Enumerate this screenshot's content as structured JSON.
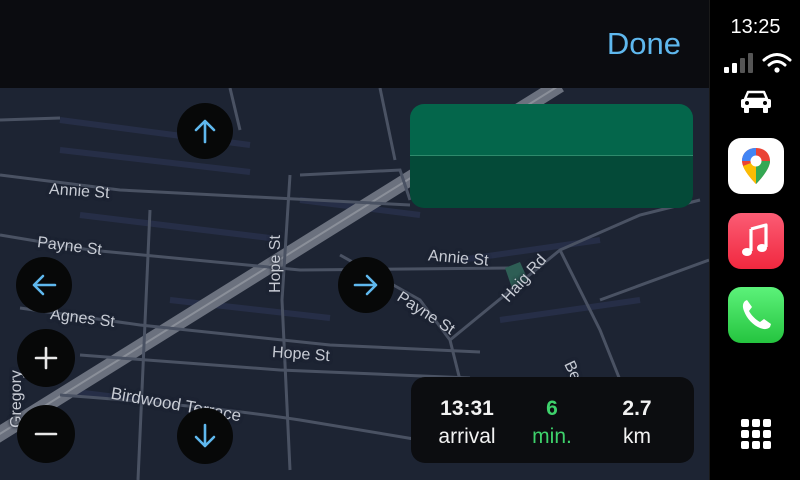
{
  "header": {
    "done_label": "Done"
  },
  "map": {
    "streets": [
      "Annie St",
      "Payne St",
      "Annie St",
      "Hope St",
      "Payne St",
      "Agnes St",
      "Hope St",
      "Haig Rd",
      "Birdwood Terrace",
      "Gregory",
      "Be"
    ]
  },
  "eta": {
    "arrival_time": "13:31",
    "arrival_label": "arrival",
    "minutes": "6",
    "minutes_label": "min.",
    "distance": "2.7",
    "distance_label": "km",
    "minutes_color": "#3ed16b"
  },
  "status": {
    "time": "13:25"
  },
  "icons": {
    "car": "car-icon",
    "maps": "google-maps-icon",
    "music": "music-icon",
    "phone": "phone-icon",
    "grid": "app-grid-icon"
  },
  "colors": {
    "accent": "#5fb8ee",
    "map_bg": "#1d2433",
    "card_green": "#04664b"
  }
}
